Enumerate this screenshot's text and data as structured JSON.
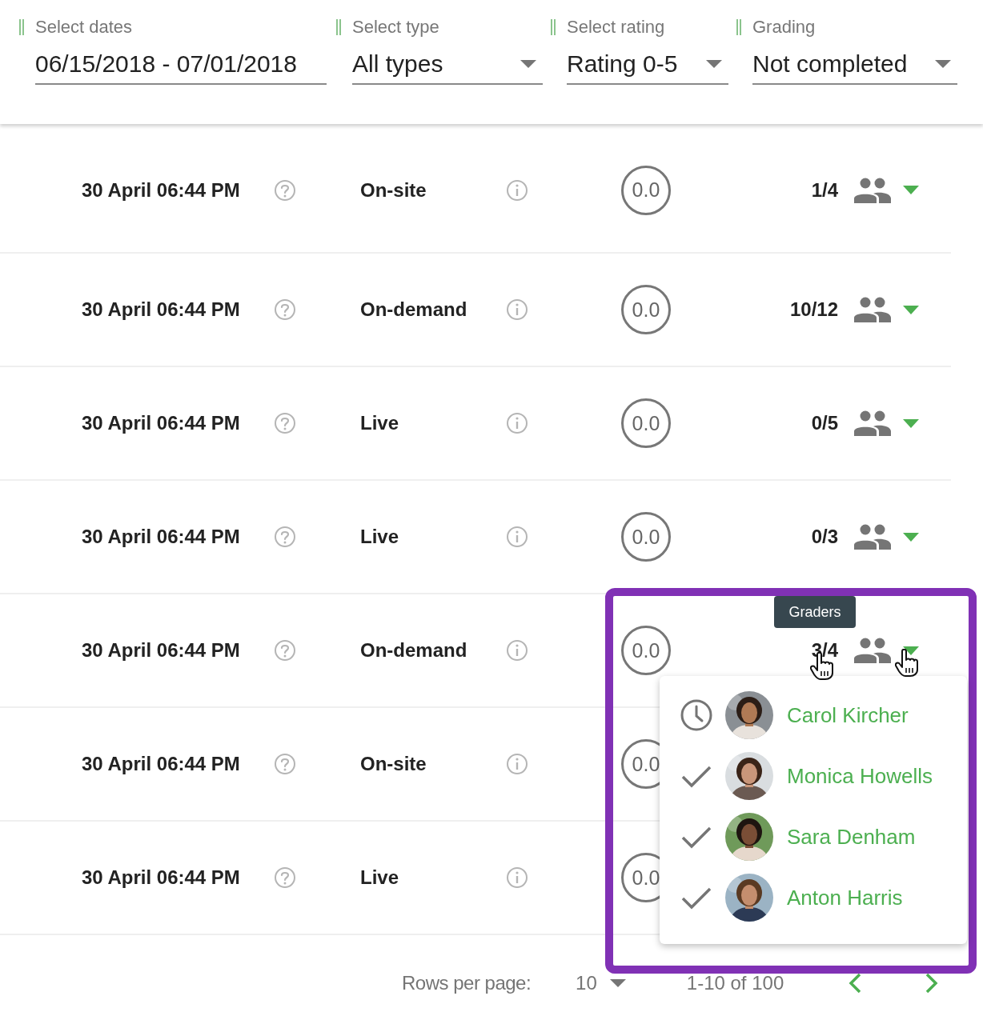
{
  "filters": [
    {
      "label": "Select dates",
      "value": "06/15/2018 - 07/01/2018",
      "kind": "text"
    },
    {
      "label": "Select type",
      "value": "All types",
      "kind": "select"
    },
    {
      "label": "Select rating",
      "value": "Rating 0-5",
      "kind": "select"
    },
    {
      "label": "Grading",
      "value": "Not completed",
      "kind": "select"
    }
  ],
  "rows": [
    {
      "date": "30 April 06:44 PM",
      "type": "On-site",
      "rating": "0.0",
      "graders": "1/4"
    },
    {
      "date": "30 April 06:44 PM",
      "type": "On-demand",
      "rating": "0.0",
      "graders": "10/12"
    },
    {
      "date": "30 April 06:44 PM",
      "type": "Live",
      "rating": "0.0",
      "graders": "0/5"
    },
    {
      "date": "30 April 06:44 PM",
      "type": "Live",
      "rating": "0.0",
      "graders": "0/3"
    },
    {
      "date": "30 April 06:44 PM",
      "type": "On-demand",
      "rating": "0.0",
      "graders": "3/4"
    },
    {
      "date": "30 April 06:44 PM",
      "type": "On-site",
      "rating": "0.0"
    },
    {
      "date": "30 April 06:44 PM",
      "type": "Live",
      "rating": "0.0"
    }
  ],
  "tooltip": "Graders",
  "grader_menu": [
    {
      "name": "Carol Kircher",
      "kind": "pending"
    },
    {
      "name": "Monica Howells",
      "kind": "done"
    },
    {
      "name": "Sara Denham",
      "kind": "done"
    },
    {
      "name": "Anton Harris",
      "kind": "done"
    }
  ],
  "pagination": {
    "rows_per_page_label": "Rows per page:",
    "rows_per_page": "10",
    "range": "1-10 of 100"
  }
}
